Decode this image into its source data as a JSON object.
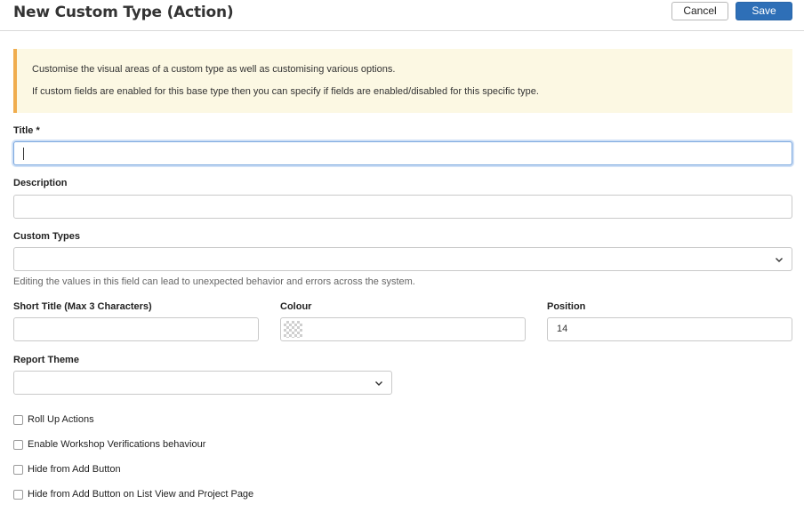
{
  "header": {
    "title": "New Custom Type (Action)",
    "cancel_label": "Cancel",
    "save_label": "Save"
  },
  "info_alert": {
    "line1": "Customise the visual areas of a custom type as well as customising various options.",
    "line2": "If custom fields are enabled for this base type then you can specify if fields are enabled/disabled for this specific type."
  },
  "form": {
    "title": {
      "label": "Title *",
      "value": ""
    },
    "description": {
      "label": "Description",
      "value": ""
    },
    "custom_types": {
      "label": "Custom Types",
      "value": "",
      "help": "Editing the values in this field can lead to unexpected behavior and errors across the system."
    },
    "short_title": {
      "label": "Short Title (Max 3 Characters)",
      "value": ""
    },
    "colour": {
      "label": "Colour",
      "value": ""
    },
    "position": {
      "label": "Position",
      "value": "14"
    },
    "report_theme": {
      "label": "Report Theme",
      "value": ""
    },
    "checkboxes": [
      {
        "label": "Roll Up Actions",
        "checked": false
      },
      {
        "label": "Enable Workshop Verifications behaviour",
        "checked": false
      },
      {
        "label": "Hide from Add Button",
        "checked": false
      },
      {
        "label": "Hide from Add Button on List View and Project Page",
        "checked": false
      }
    ]
  },
  "colors": {
    "primary": "#2e6fb7",
    "alert_bg": "#fcf8e3",
    "alert_accent": "#f0ad4e",
    "focus_ring": "#7aa7de"
  }
}
